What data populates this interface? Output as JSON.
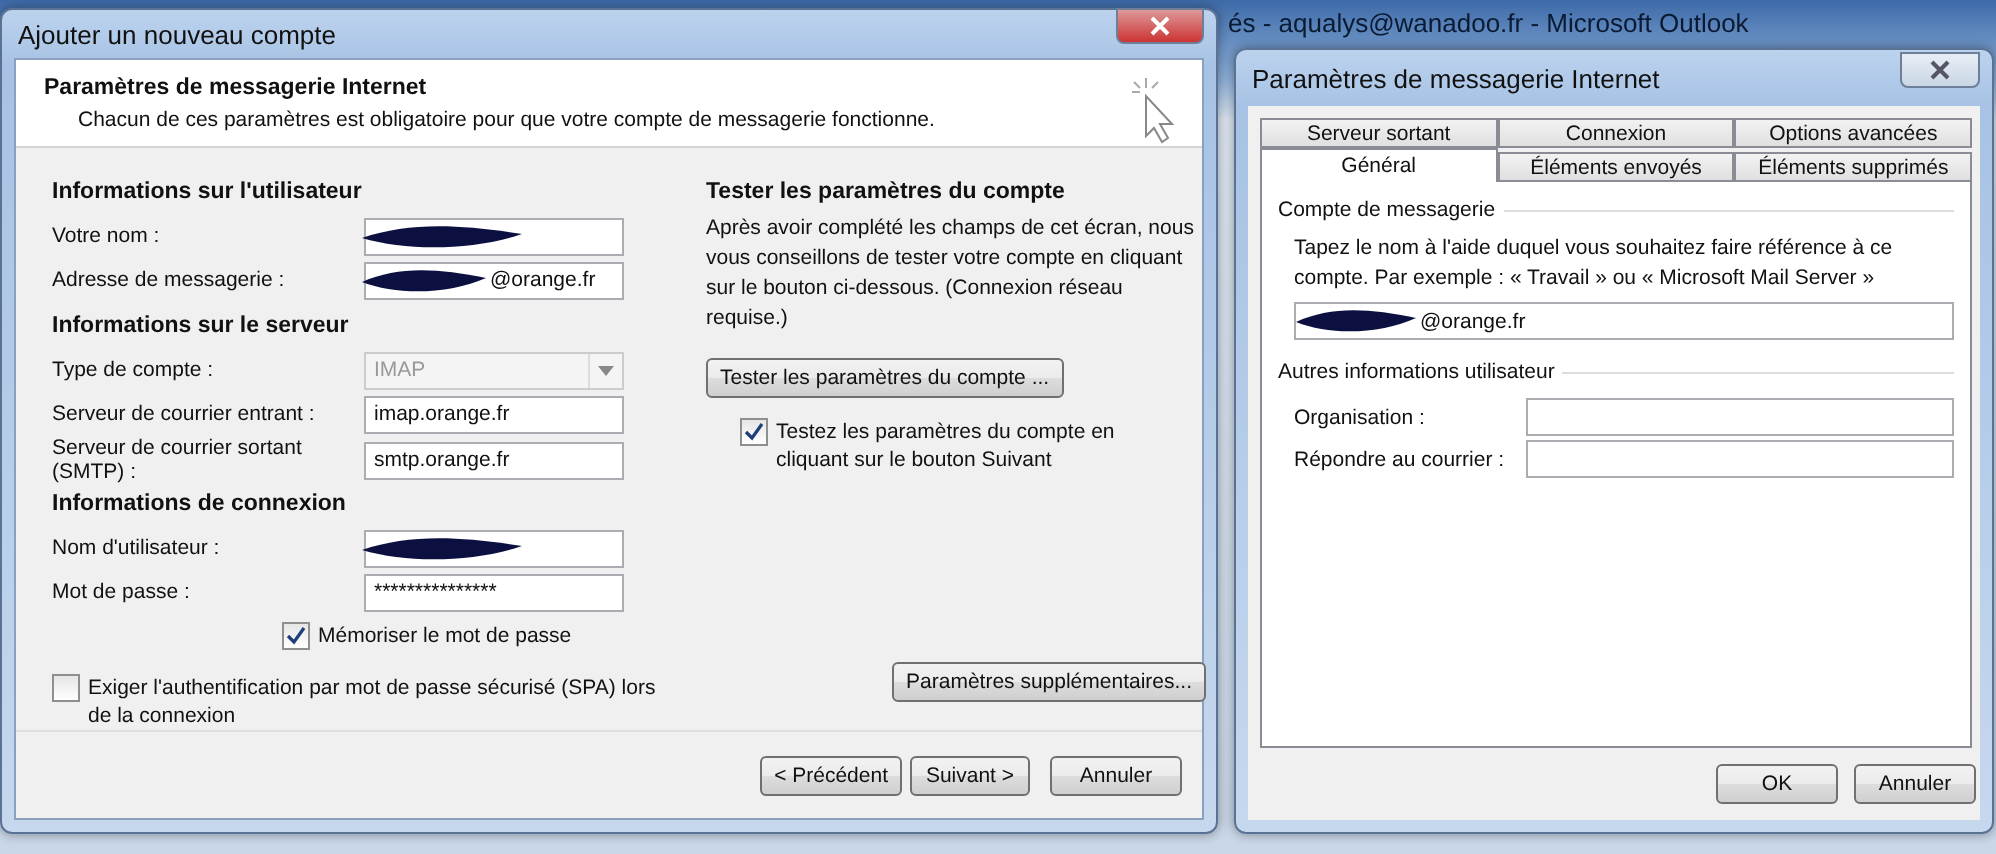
{
  "background_window": {
    "title": "és - aqualys@wanadoo.fr - Microsoft Outlook"
  },
  "left_dialog": {
    "title": "Ajouter un nouveau compte",
    "header": {
      "title": "Paramètres de messagerie Internet",
      "subtitle": "Chacun de ces paramètres est obligatoire pour que votre compte de messagerie fonctionne."
    },
    "sections": [
      {
        "heading": "Informations sur l'utilisateur",
        "fields": [
          {
            "kind": "text",
            "label": "Votre nom :",
            "redacted": true
          },
          {
            "kind": "text",
            "label": "Adresse de messagerie :",
            "value": "@orange.fr",
            "redacted": true
          }
        ]
      },
      {
        "heading": "Informations sur le serveur",
        "fields": [
          {
            "kind": "dropdown",
            "label": "Type de compte :",
            "value": "IMAP",
            "disabled": true
          },
          {
            "kind": "text",
            "label": "Serveur de courrier entrant :",
            "value": "imap.orange.fr"
          },
          {
            "kind": "text",
            "label": "Serveur de courrier sortant (SMTP) :",
            "value": "smtp.orange.fr"
          }
        ]
      },
      {
        "heading": "Informations de connexion",
        "fields": [
          {
            "kind": "text",
            "label": "Nom d'utilisateur :",
            "redacted": true
          },
          {
            "kind": "text",
            "label": "Mot de passe :",
            "value": "***************"
          }
        ]
      }
    ],
    "remember_checkbox": {
      "label": "Mémoriser le mot de passe",
      "checked": true
    },
    "spa_checkbox": {
      "label": "Exiger l'authentification par mot de passe sécurisé (SPA) lors de la connexion",
      "checked": false
    },
    "test_section": {
      "heading": "Tester les paramètres du compte",
      "description": "Après avoir complété les champs de cet écran, nous vous conseillons de tester votre compte en cliquant sur le bouton ci-dessous. (Connexion réseau requise.)",
      "button": "Tester les paramètres du compte ...",
      "checkbox": {
        "label": "Testez les paramètres du compte en cliquant sur le bouton Suivant",
        "checked": true
      }
    },
    "more_button": "Paramètres supplémentaires...",
    "footer_buttons": [
      "< Précédent",
      "Suivant >",
      "Annuler"
    ]
  },
  "right_dialog": {
    "title": "Paramètres de messagerie Internet",
    "tab_rows": [
      {
        "tabs": [
          {
            "label": "Serveur sortant",
            "selected": false
          },
          {
            "label": "Connexion",
            "selected": false
          },
          {
            "label": "Options avancées",
            "selected": false
          }
        ]
      },
      {
        "tabs": [
          {
            "label": "Général",
            "selected": true
          },
          {
            "label": "Éléments envoyés",
            "selected": false
          },
          {
            "label": "Éléments supprimés",
            "selected": false
          }
        ]
      }
    ],
    "account_group": {
      "heading": "Compte de messagerie",
      "description": "Tapez le nom à l'aide duquel vous souhaitez faire référence à ce compte. Par exemple : « Travail » ou « Microsoft Mail Server »",
      "value": "@orange.fr",
      "redacted": true
    },
    "user_group": {
      "heading": "Autres informations utilisateur",
      "fields": [
        {
          "label": "Organisation :"
        },
        {
          "label": "Répondre au courrier :"
        }
      ]
    },
    "buttons": [
      "OK",
      "Annuler"
    ]
  }
}
